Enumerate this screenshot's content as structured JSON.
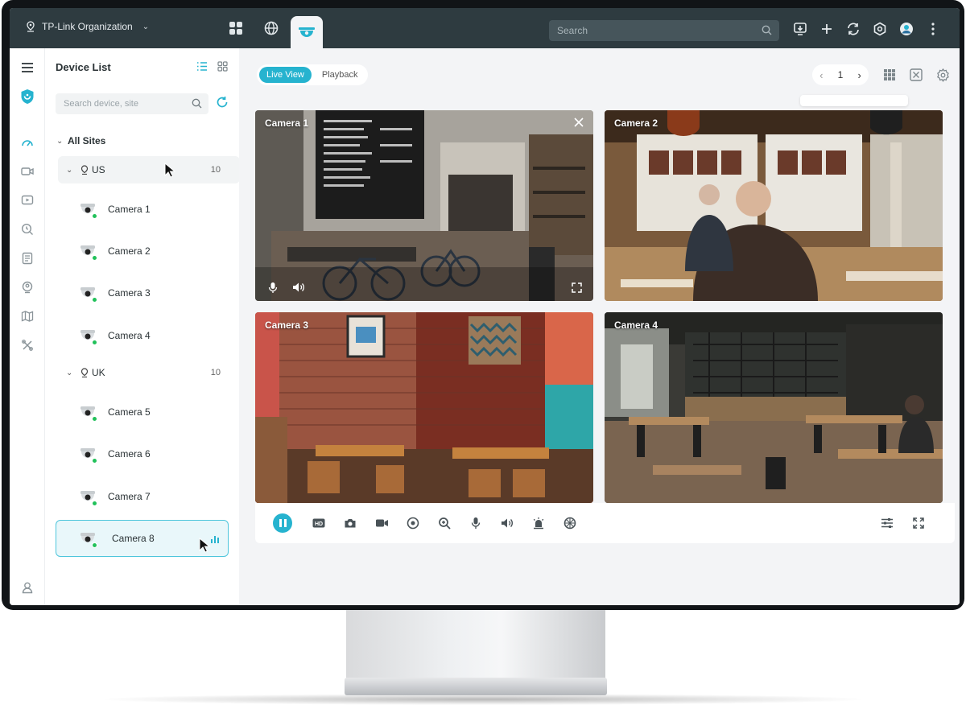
{
  "topbar": {
    "org_name": "TP-Link Organization",
    "search_placeholder": "Search"
  },
  "device_panel": {
    "title": "Device List",
    "search_placeholder": "Search device, site",
    "all_sites_label": "All Sites",
    "sites": [
      {
        "name": "US",
        "count": "10",
        "cameras": [
          "Camera 1",
          "Camera 2",
          "Camera 3",
          "Camera 4"
        ]
      },
      {
        "name": "UK",
        "count": "10",
        "cameras": [
          "Camera 5",
          "Camera 6",
          "Camera 7",
          "Camera 8"
        ]
      }
    ],
    "selected_camera": "Camera 8"
  },
  "main": {
    "tabs": [
      {
        "label": "Live View",
        "active": true
      },
      {
        "label": "Playback",
        "active": false
      }
    ],
    "page_number": "1",
    "tiles": [
      {
        "label": "Camera 1",
        "scene": "cafe-bicycles"
      },
      {
        "label": "Camera 2",
        "scene": "cafe-window-man"
      },
      {
        "label": "Camera 3",
        "scene": "brick-restaurant"
      },
      {
        "label": "Camera 4",
        "scene": "industrial-coffee-shop"
      }
    ]
  },
  "colors": {
    "topbar": "#2e3b40",
    "accent": "#26b3cf",
    "online": "#21c15a",
    "background": "#f3f4f6"
  },
  "icons": {
    "toolbar": [
      "pause-icon",
      "hd-icon",
      "snapshot-icon",
      "record-icon",
      "ptz-icon",
      "zoom-icon",
      "microphone-icon",
      "speaker-icon",
      "alarm-icon",
      "fisheye-icon"
    ],
    "rail": [
      "shield-logo-icon",
      "dashboard-icon",
      "devices-icon",
      "playback-icon",
      "search-history-icon",
      "log-icon",
      "user-location-icon",
      "map-icon",
      "tools-icon",
      "account-icon"
    ]
  }
}
